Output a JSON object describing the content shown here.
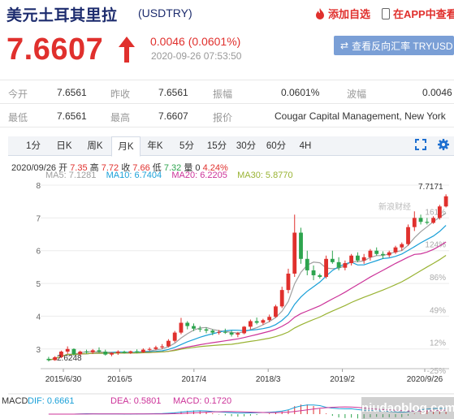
{
  "header": {
    "title": "美元土耳其里拉",
    "code": "(USDTRY)",
    "fav_label": "添加自选",
    "app_label": "在APP中查看"
  },
  "quote": {
    "price": "7.6607",
    "change": "0.0046 (0.0601%)",
    "time": "2020-09-26 07:53:50",
    "reverse_button": "查看反向汇率 TRYUSD"
  },
  "stats": {
    "row1": [
      {
        "label": "今开",
        "value": "7.6561"
      },
      {
        "label": "昨收",
        "value": "7.6561"
      },
      {
        "label": "振幅",
        "value": "0.0601%"
      },
      {
        "label": "波幅",
        "value": "0.0046"
      }
    ],
    "row2": [
      {
        "label": "最低",
        "value": "7.6561"
      },
      {
        "label": "最高",
        "value": "7.6607"
      },
      {
        "label": "报价",
        "value": "Cougar Capital Management, New York"
      }
    ]
  },
  "tabs": [
    "1分",
    "日K",
    "周K",
    "月K",
    "年K",
    "5分",
    "15分",
    "30分",
    "60分",
    "4H"
  ],
  "active_tab": "月K",
  "icons": {
    "expand": "expand-icon",
    "settings": "settings-icon",
    "arrow": "up-arrow-icon"
  },
  "colors": {
    "up": "#e0302d",
    "down": "#2da44e",
    "ma5": "#9f9f9f",
    "ma10": "#1aa0d8",
    "ma20": "#cc3399",
    "ma30": "#99b333"
  },
  "chart_info": {
    "ohlc_line": {
      "date": "2020/09/26",
      "open_label": "开",
      "open": "7.35",
      "high_label": "高",
      "high": "7.72",
      "close_label": "收",
      "close": "7.66",
      "low_label": "低",
      "low": "7.32",
      "vol_label": "量",
      "vol": "0",
      "pct": "4.24%"
    },
    "ma": {
      "ma5": "MA5: 7.1281",
      "ma10": "MA10: 6.7404",
      "ma20": "MA20: 6.2205",
      "ma30": "MA30: 5.8770"
    },
    "max_label": "7.7171",
    "min_label": "2.6248",
    "pct_ticks": [
      "161%",
      "124%",
      "86%",
      "49%",
      "12%",
      "-25%"
    ],
    "source_logo": "新浪财经",
    "macd": {
      "title": "MACD",
      "dif": "DIF: 0.6661",
      "dea": "DEA: 0.5801",
      "macd": "MACD: 0.1720"
    }
  },
  "watermark": "niudaoblog.com",
  "chart_data": {
    "type": "candlestick",
    "y_ticks": [
      3,
      4,
      5,
      6,
      7,
      8
    ],
    "ylim": [
      2.4,
      8.0
    ],
    "x_tick_labels": [
      "2015/6/30",
      "2016/5",
      "2017/4",
      "2018/3",
      "2019/2",
      "2020/9/26"
    ],
    "candles": [
      [
        2.7,
        2.76,
        2.62,
        2.66
      ],
      [
        2.66,
        2.78,
        2.64,
        2.75
      ],
      [
        2.75,
        2.95,
        2.72,
        2.92
      ],
      [
        2.92,
        3.08,
        2.85,
        3.0
      ],
      [
        3.0,
        3.02,
        2.8,
        2.84
      ],
      [
        2.84,
        2.95,
        2.78,
        2.92
      ],
      [
        2.92,
        2.98,
        2.86,
        2.9
      ],
      [
        2.9,
        3.0,
        2.85,
        2.96
      ],
      [
        2.96,
        3.05,
        2.88,
        2.92
      ],
      [
        2.92,
        2.98,
        2.8,
        2.83
      ],
      [
        2.83,
        2.9,
        2.78,
        2.88
      ],
      [
        2.88,
        2.96,
        2.82,
        2.92
      ],
      [
        2.92,
        2.95,
        2.86,
        2.88
      ],
      [
        2.88,
        2.95,
        2.85,
        2.93
      ],
      [
        2.93,
        2.99,
        2.87,
        2.9
      ],
      [
        2.9,
        3.02,
        2.88,
        2.98
      ],
      [
        2.98,
        3.05,
        2.93,
        3.0
      ],
      [
        3.0,
        3.1,
        2.96,
        3.05
      ],
      [
        3.05,
        3.15,
        3.0,
        3.08
      ],
      [
        3.08,
        3.3,
        3.05,
        3.25
      ],
      [
        3.25,
        3.55,
        3.2,
        3.5
      ],
      [
        3.5,
        3.95,
        3.45,
        3.8
      ],
      [
        3.8,
        3.85,
        3.6,
        3.7
      ],
      [
        3.7,
        3.78,
        3.55,
        3.62
      ],
      [
        3.62,
        3.7,
        3.52,
        3.6
      ],
      [
        3.6,
        3.66,
        3.48,
        3.56
      ],
      [
        3.56,
        3.6,
        3.42,
        3.5
      ],
      [
        3.5,
        3.58,
        3.44,
        3.52
      ],
      [
        3.52,
        3.62,
        3.46,
        3.5
      ],
      [
        3.5,
        3.56,
        3.38,
        3.44
      ],
      [
        3.44,
        3.52,
        3.36,
        3.48
      ],
      [
        3.48,
        3.7,
        3.45,
        3.68
      ],
      [
        3.68,
        3.9,
        3.6,
        3.85
      ],
      [
        3.85,
        3.96,
        3.75,
        3.8
      ],
      [
        3.8,
        3.92,
        3.74,
        3.88
      ],
      [
        3.88,
        4.05,
        3.82,
        3.98
      ],
      [
        3.98,
        4.35,
        3.95,
        4.3
      ],
      [
        4.3,
        4.9,
        4.25,
        4.8
      ],
      [
        4.8,
        5.45,
        4.7,
        5.3
      ],
      [
        5.3,
        7.1,
        5.2,
        6.55
      ],
      [
        6.55,
        6.7,
        5.6,
        5.75
      ],
      [
        5.75,
        6.0,
        5.25,
        5.4
      ],
      [
        5.4,
        5.55,
        5.1,
        5.25
      ],
      [
        5.25,
        5.3,
        5.15,
        5.2
      ],
      [
        5.2,
        5.85,
        5.15,
        5.75
      ],
      [
        5.75,
        6.0,
        5.6,
        5.65
      ],
      [
        5.65,
        5.8,
        5.4,
        5.48
      ],
      [
        5.48,
        5.7,
        5.4,
        5.62
      ],
      [
        5.62,
        5.9,
        5.55,
        5.85
      ],
      [
        5.85,
        5.95,
        5.65,
        5.7
      ],
      [
        5.7,
        5.9,
        5.6,
        5.8
      ],
      [
        5.8,
        6.05,
        5.7,
        6.0
      ],
      [
        6.0,
        6.1,
        5.85,
        5.9
      ],
      [
        5.9,
        5.98,
        5.75,
        5.86
      ],
      [
        5.86,
        6.0,
        5.8,
        5.95
      ],
      [
        5.95,
        6.15,
        5.9,
        6.1
      ],
      [
        6.1,
        6.25,
        6.0,
        6.2
      ],
      [
        6.2,
        6.8,
        6.15,
        6.72
      ],
      [
        6.72,
        7.2,
        6.6,
        7.0
      ],
      [
        7.0,
        7.1,
        6.8,
        6.88
      ],
      [
        6.88,
        7.0,
        6.8,
        6.85
      ],
      [
        6.85,
        7.05,
        6.82,
        7.0
      ],
      [
        7.0,
        7.4,
        6.95,
        7.35
      ],
      [
        7.35,
        7.72,
        7.32,
        7.66
      ]
    ]
  }
}
